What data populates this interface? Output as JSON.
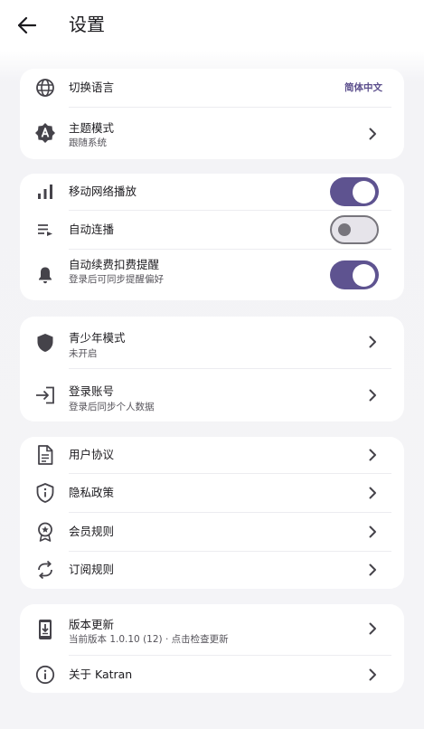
{
  "header": {
    "title": "设置",
    "back_icon": "arrow-back-icon"
  },
  "colors": {
    "accent": "#5e5390",
    "value_text": "#5b4e8c",
    "icon": "#45434a",
    "background": "#f4f4f7",
    "card": "#ffffff"
  },
  "general": {
    "language": {
      "title": "切换语言",
      "value": "简体中文",
      "icon": "globe-icon"
    },
    "theme": {
      "title": "主题模式",
      "subtitle": "跟随系统",
      "icon": "theme-badge-icon"
    }
  },
  "playback": {
    "mobile_network": {
      "title": "移动网络播放",
      "enabled": true,
      "icon": "signal-bars-icon"
    },
    "autoplay": {
      "title": "自动连播",
      "enabled": false,
      "icon": "queue-play-icon"
    },
    "renewal_reminder": {
      "title": "自动续费扣费提醒",
      "subtitle": "登录后可同步提醒偏好",
      "enabled": true,
      "icon": "bell-icon"
    }
  },
  "account": {
    "teen_mode": {
      "title": "青少年模式",
      "subtitle": "未开启",
      "icon": "shield-icon"
    },
    "login": {
      "title": "登录账号",
      "subtitle": "登录后同步个人数据",
      "icon": "login-icon"
    }
  },
  "policies": {
    "user_agreement": {
      "title": "用户协议",
      "icon": "document-icon"
    },
    "privacy_policy": {
      "title": "隐私政策",
      "icon": "privacy-shield-icon"
    },
    "membership_rules": {
      "title": "会员规则",
      "icon": "award-badge-icon"
    },
    "subscription_rules": {
      "title": "订阅规则",
      "icon": "sync-icon"
    }
  },
  "about": {
    "version_update": {
      "title": "版本更新",
      "subtitle": "当前版本 1.0.10 (12) · 点击检查更新",
      "icon": "phone-download-icon"
    },
    "about_app": {
      "title": "关于 Katran",
      "icon": "info-icon"
    }
  }
}
